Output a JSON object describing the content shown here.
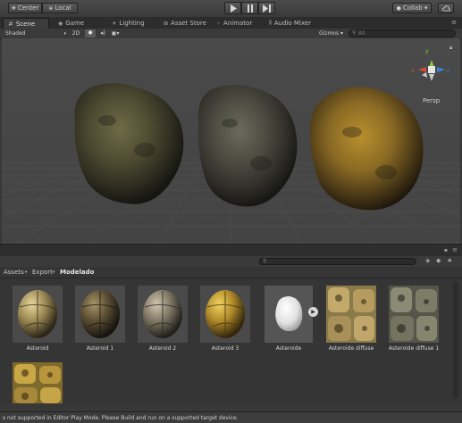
{
  "toolbar": {
    "center_label": "Center",
    "local_label": "Local",
    "collab_label": "Collab ▾",
    "play_icon": "play-icon",
    "pause_icon": "pause-icon",
    "step_icon": "step-icon",
    "cloud_icon": "cloud-icon"
  },
  "tabs": [
    {
      "label": "Scene",
      "icon": "scene-icon",
      "active": true
    },
    {
      "label": "Game",
      "icon": "game-icon"
    },
    {
      "label": "Lighting",
      "icon": "lighting-icon"
    },
    {
      "label": "Asset Store",
      "icon": "asset-store-icon"
    },
    {
      "label": "Animator",
      "icon": "animator-icon"
    },
    {
      "label": "Audio Mixer",
      "icon": "audio-mixer-icon"
    }
  ],
  "scene_toolbar": {
    "shading_mode": "Shaded",
    "mode_2d": "2D",
    "gizmos_label": "Gizmos ▾",
    "search_placeholder": "All"
  },
  "scene": {
    "gizmo_x": "x",
    "gizmo_y": "y",
    "gizmo_z": "z",
    "persp_label": "Persp"
  },
  "breadcrumb": {
    "items": [
      "Assets",
      "Export",
      "Modelado"
    ],
    "separator": "▸"
  },
  "assets": [
    {
      "name": "Asteroid",
      "kind": "material-tan"
    },
    {
      "name": "Asteroid 1",
      "kind": "material-dark"
    },
    {
      "name": "Asteroid 2",
      "kind": "material-grey"
    },
    {
      "name": "Asteroid 3",
      "kind": "material-gold"
    },
    {
      "name": "Asteroide",
      "kind": "mesh"
    },
    {
      "name": "Asteroide diffuse",
      "kind": "texture-tan"
    },
    {
      "name": "Asteroide diffuse 1",
      "kind": "texture-grey"
    },
    {
      "name": "",
      "kind": "texture-gold"
    }
  ],
  "status": {
    "message": "s not supported in Editor Play Mode. Please Build and run on a supported target device."
  },
  "colors": {
    "accent_tab": "#3c3c3c",
    "gizmo_x": "#d34c3c",
    "gizmo_y": "#8ccf3c",
    "gizmo_z": "#3c7fd3"
  }
}
